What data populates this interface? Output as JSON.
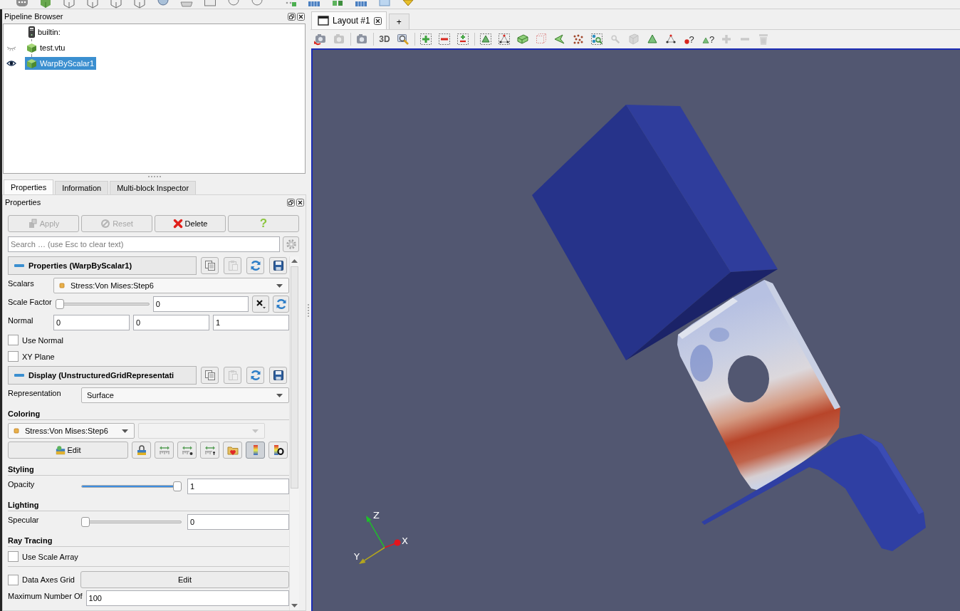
{
  "pipeline_browser": {
    "title": "Pipeline Browser",
    "items": [
      {
        "kind": "server",
        "label": "builtin:",
        "selected": false
      },
      {
        "kind": "source",
        "label": "test.vtu",
        "visible": false,
        "selected": false
      },
      {
        "kind": "source",
        "label": "WarpByScalar1",
        "visible": true,
        "selected": true
      }
    ]
  },
  "panel_tabs": [
    {
      "label": "Properties",
      "selected": true
    },
    {
      "label": "Information",
      "selected": false
    },
    {
      "label": "Multi-block Inspector",
      "selected": false
    }
  ],
  "properties_panel": {
    "title": "Properties",
    "buttons": [
      {
        "kind": "apply",
        "label": "Apply",
        "disabled": true
      },
      {
        "kind": "reset",
        "label": "Reset",
        "disabled": true
      },
      {
        "kind": "delete",
        "label": "Delete",
        "disabled": false
      },
      {
        "kind": "help",
        "label": "?",
        "disabled": false
      }
    ],
    "search": {
      "placeholder": "Search … (use Esc to clear text)"
    },
    "sections": [
      {
        "kind": "source",
        "title": "Properties (WarpByScalar1)",
        "expanded": true,
        "tools": [
          {
            "kind": "copy",
            "disabled": false
          },
          {
            "kind": "paste",
            "disabled": true
          },
          {
            "kind": "reload",
            "disabled": false
          },
          {
            "kind": "save",
            "disabled": false
          }
        ],
        "rows": [
          {
            "kind": "array",
            "label": "Scalars",
            "value": "Stress:Von Mises:Step6"
          },
          {
            "kind": "scale",
            "label": "Scale Factor",
            "level": 0,
            "value": "0"
          },
          {
            "kind": "vector",
            "label": "Normal",
            "values": [
              "0",
              "0",
              "1"
            ]
          },
          {
            "kind": "checkbox",
            "label": "Use Normal",
            "checked": false
          },
          {
            "kind": "checkbox",
            "label": "XY Plane",
            "checked": false
          }
        ]
      },
      {
        "kind": "display",
        "title": "Display (UnstructuredGridRepresentati",
        "expanded": true,
        "tools": [
          {
            "kind": "copy",
            "disabled": false
          },
          {
            "kind": "paste",
            "disabled": true
          },
          {
            "kind": "reload",
            "disabled": false
          },
          {
            "kind": "save",
            "disabled": false
          }
        ],
        "rows": [
          {
            "kind": "dropdown",
            "label": "Representation",
            "value": "Surface"
          },
          {
            "kind": "heading",
            "label": "Coloring"
          },
          {
            "kind": "coloring",
            "value": "Stress:Von Mises:Step6",
            "component": {
              "disabled": true
            },
            "edit": "Edit",
            "tools": [
              {
                "kind": "lock",
                "on": false
              },
              {
                "kind": "rescale",
                "on": false
              },
              {
                "kind": "custom",
                "on": false
              },
              {
                "kind": "temporal",
                "on": false
              },
              {
                "kind": "favorites",
                "on": false
              },
              {
                "kind": "legend",
                "on": true
              },
              {
                "kind": "editor",
                "on": false
              }
            ]
          },
          {
            "kind": "heading",
            "label": "Styling"
          },
          {
            "kind": "slider",
            "label": "Opacity",
            "level": 1,
            "value": "1"
          },
          {
            "kind": "heading",
            "label": "Lighting"
          },
          {
            "kind": "slider",
            "label": "Specular",
            "level": 0,
            "value": "0"
          },
          {
            "kind": "heading",
            "label": "Ray Tracing"
          },
          {
            "kind": "checkbox",
            "label": "Use Scale Array",
            "checked": false
          },
          {
            "kind": "checkbox_button",
            "label": "Data Axes Grid",
            "checked": false,
            "button": "Edit"
          },
          {
            "kind": "text",
            "label": "Maximum Number Of",
            "value": "100"
          }
        ]
      }
    ]
  },
  "layout_tabs": [
    {
      "kind": "layout",
      "label": "Layout #1",
      "selected": true
    },
    {
      "kind": "add",
      "label": "+",
      "selected": false
    }
  ],
  "view_toolbar": {
    "groups": [
      {
        "buttons": [
          {
            "kind": "undo",
            "disabled": false
          },
          {
            "kind": "redo",
            "disabled": true
          }
        ]
      },
      {
        "buttons": [
          {
            "kind": "capture",
            "disabled": false
          }
        ]
      },
      {
        "buttons": [
          {
            "kind": "mode",
            "label": "3D",
            "disabled": false
          },
          {
            "kind": "zoombox",
            "disabled": false
          }
        ]
      },
      {
        "buttons": [
          {
            "kind": "add",
            "disabled": false
          },
          {
            "kind": "subtract",
            "disabled": false
          },
          {
            "kind": "toggle",
            "disabled": false
          }
        ]
      },
      {
        "buttons": [
          {
            "kind": "surfcells",
            "disabled": false
          },
          {
            "kind": "surfpoints",
            "disabled": false
          },
          {
            "kind": "frustumcells",
            "disabled": false
          },
          {
            "kind": "frustumpoints",
            "disabled": false
          },
          {
            "kind": "polycells",
            "disabled": false
          },
          {
            "kind": "polypoints",
            "disabled": false
          },
          {
            "kind": "blocks",
            "disabled": false
          },
          {
            "kind": "interactive",
            "disabled": true
          },
          {
            "kind": "extract",
            "disabled": true
          },
          {
            "kind": "hovercells",
            "disabled": false
          },
          {
            "kind": "hoverpoints",
            "disabled": false
          },
          {
            "kind": "querypoint",
            "label": "?",
            "disabled": false
          },
          {
            "kind": "querycell",
            "label": "?",
            "disabled": false
          },
          {
            "kind": "grow",
            "disabled": true
          },
          {
            "kind": "shrink",
            "disabled": true
          },
          {
            "kind": "clear",
            "disabled": true
          }
        ]
      }
    ]
  },
  "render_view": {
    "active": true,
    "axes": [
      {
        "kind": "cone",
        "label": "Z",
        "color": "#1fbf2a"
      },
      {
        "kind": "sphere",
        "label": "X",
        "color": "#e5141c"
      },
      {
        "kind": "cone",
        "label": "Y",
        "color": "#b3a51e"
      }
    ]
  }
}
